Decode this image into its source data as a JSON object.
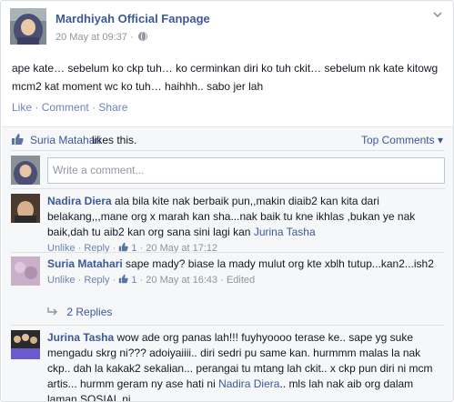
{
  "post": {
    "page_name": "Mardhiyah Official Fanpage",
    "timestamp": "20 May at 09:37",
    "separator": "·",
    "text": "ape kate… sebelum ko ckp tuh… ko cerminkan diri ko tuh ckit… sebelum nk kate kitowg mcm2 kat moment wc ko tuh… haihhh.. sabo jer lah",
    "actions": {
      "like": "Like",
      "comment": "Comment",
      "share": "Share",
      "dot": "·"
    }
  },
  "ufi": {
    "liker": "Suria Matahari",
    "likes_suffix": "likes this.",
    "top_comments": "Top Comments ▾",
    "composer_placeholder": "Write a comment...",
    "comments": [
      {
        "name": "Nadira Diera",
        "text": "ala bila kite nak berbaik pun,,makin diaib2 kan kita dari belakang,,,mane org x marah kan sha...nak baik tu kne ikhlas ,bukan ye nak baik,dah tu aib2 kan org sana sini lagi kan",
        "mention": "Jurina Tasha",
        "unlike": "Unlike",
        "reply": "Reply",
        "like_count": "1",
        "time": "20 May at 17:12",
        "edited": ""
      },
      {
        "name": "Suria Matahari",
        "text": "sape mady? biase la mady mulut org kte xblh tutup...kan2...ish2",
        "mention": "",
        "unlike": "Unlike",
        "reply": "Reply",
        "like_count": "1",
        "time": "20 May at 16:43",
        "edited": "Edited"
      },
      {
        "name": "Jurina Tasha",
        "text_before": "wow ade org panas lah!!! fuyhyoooo terase ke.. sape yg suke mengadu skrg ni??? adoiyaiiii.. diri sedri pu same kan. hurmmm malas la nak ckp.. dah la kakak2 sekalian... perangai tu mtang lah ckit.. x ckp pun diri ni mcm artis... hurmm geram ny ase hati ni",
        "mention": "Nadira Diera",
        "text_after": ".. mls lah nak aib org dalam laman SOSIAL ni"
      }
    ],
    "replies_label": "2 Replies"
  },
  "colors": {
    "link": "#3b5998",
    "muted": "#90949c",
    "ufi_bg": "#f6f7f9"
  },
  "icons": [
    "globe-icon",
    "chevron-down-icon",
    "thumbs-up-icon",
    "reply-arrow-icon"
  ]
}
